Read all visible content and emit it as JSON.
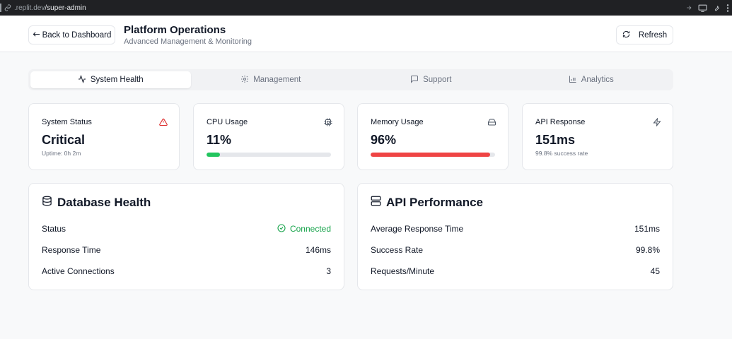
{
  "browser": {
    "url_host": ".replit.dev",
    "url_path": "/super-admin"
  },
  "header": {
    "back_label": "Back to Dashboard",
    "title": "Platform Operations",
    "subtitle": "Advanced Management & Monitoring",
    "refresh_label": "Refresh"
  },
  "tabs": [
    {
      "label": "System Health",
      "icon": "activity-icon",
      "active": true
    },
    {
      "label": "Management",
      "icon": "gear-icon",
      "active": false
    },
    {
      "label": "Support",
      "icon": "message-icon",
      "active": false
    },
    {
      "label": "Analytics",
      "icon": "bar-chart-icon",
      "active": false
    }
  ],
  "stats": {
    "system_status": {
      "label": "System Status",
      "value": "Critical",
      "sub": "Uptime: 0h 2m",
      "icon": "alert-triangle-icon"
    },
    "cpu": {
      "label": "CPU Usage",
      "value": "11%",
      "progress": 0.11,
      "color": "#22c55e",
      "icon": "cpu-icon"
    },
    "memory": {
      "label": "Memory Usage",
      "value": "96%",
      "progress": 0.96,
      "color": "#ef4444",
      "icon": "hard-drive-icon"
    },
    "api": {
      "label": "API Response",
      "value": "151ms",
      "sub": "99.8% success rate",
      "icon": "zap-icon"
    }
  },
  "database": {
    "title": "Database Health",
    "rows": [
      {
        "label": "Status",
        "value": "Connected"
      },
      {
        "label": "Response Time",
        "value": "146ms"
      },
      {
        "label": "Active Connections",
        "value": "3"
      }
    ]
  },
  "api_performance": {
    "title": "API Performance",
    "rows": [
      {
        "label": "Average Response Time",
        "value": "151ms"
      },
      {
        "label": "Success Rate",
        "value": "99.8%"
      },
      {
        "label": "Requests/Minute",
        "value": "45"
      }
    ]
  },
  "colors": {
    "critical": "#dc2626",
    "success": "#16a34a",
    "accent_bg": "#f8f9fa"
  }
}
